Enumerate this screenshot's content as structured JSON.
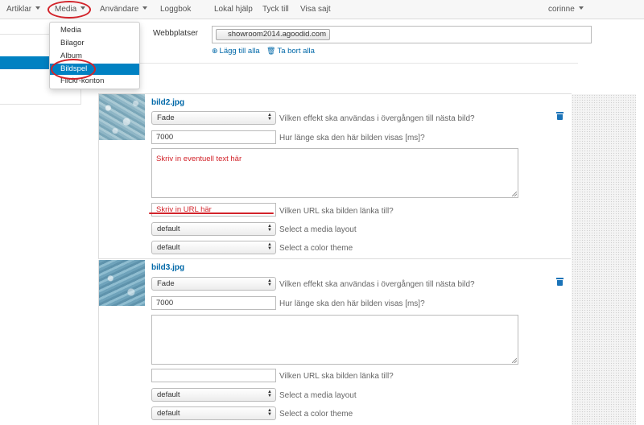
{
  "nav": {
    "artiklar": "Artiklar",
    "media": "Media",
    "anvandare": "Användare",
    "loggbok": "Loggbok",
    "lokal_hjalp": "Lokal hjälp",
    "tyck_till": "Tyck till",
    "visa_sajt": "Visa sajt",
    "user": "corinne"
  },
  "media_menu": {
    "items": [
      "Media",
      "Bilagor",
      "Album",
      "Bildspel",
      "Flickr-konton"
    ],
    "active": "Bildspel"
  },
  "sites": {
    "label": "Webbplatser",
    "tag": "showroom2014.agoodid.com",
    "add_all": "Lägg till alla",
    "remove_all": "Ta bort alla"
  },
  "slides": [
    {
      "filename": "bild2.jpg",
      "effect": "Fade",
      "effect_q": "Vilken effekt ska användas i övergången till nästa bild?",
      "duration": "7000",
      "duration_q": "Hur länge ska den här bilden visas [ms]?",
      "text_value": "Skriv in eventuell text här",
      "url_value": "Skriv in URL här",
      "url_q": "Vilken URL ska bilden länka till?",
      "layout": "default",
      "layout_q": "Select a media layout",
      "theme": "default",
      "theme_q": "Select a color theme"
    },
    {
      "filename": "bild3.jpg",
      "effect": "Fade",
      "effect_q": "Vilken effekt ska användas i övergången till nästa bild?",
      "duration": "7000",
      "duration_q": "Hur länge ska den här bilden visas [ms]?",
      "text_value": "",
      "url_value": "",
      "url_q": "Vilken URL ska bilden länka till?",
      "layout": "default",
      "layout_q": "Select a media layout",
      "theme": "default",
      "theme_q": "Select a color theme"
    }
  ],
  "colors": {
    "accent": "#0081c2",
    "link": "#0068a8",
    "annotation_red": "#d2232a"
  }
}
